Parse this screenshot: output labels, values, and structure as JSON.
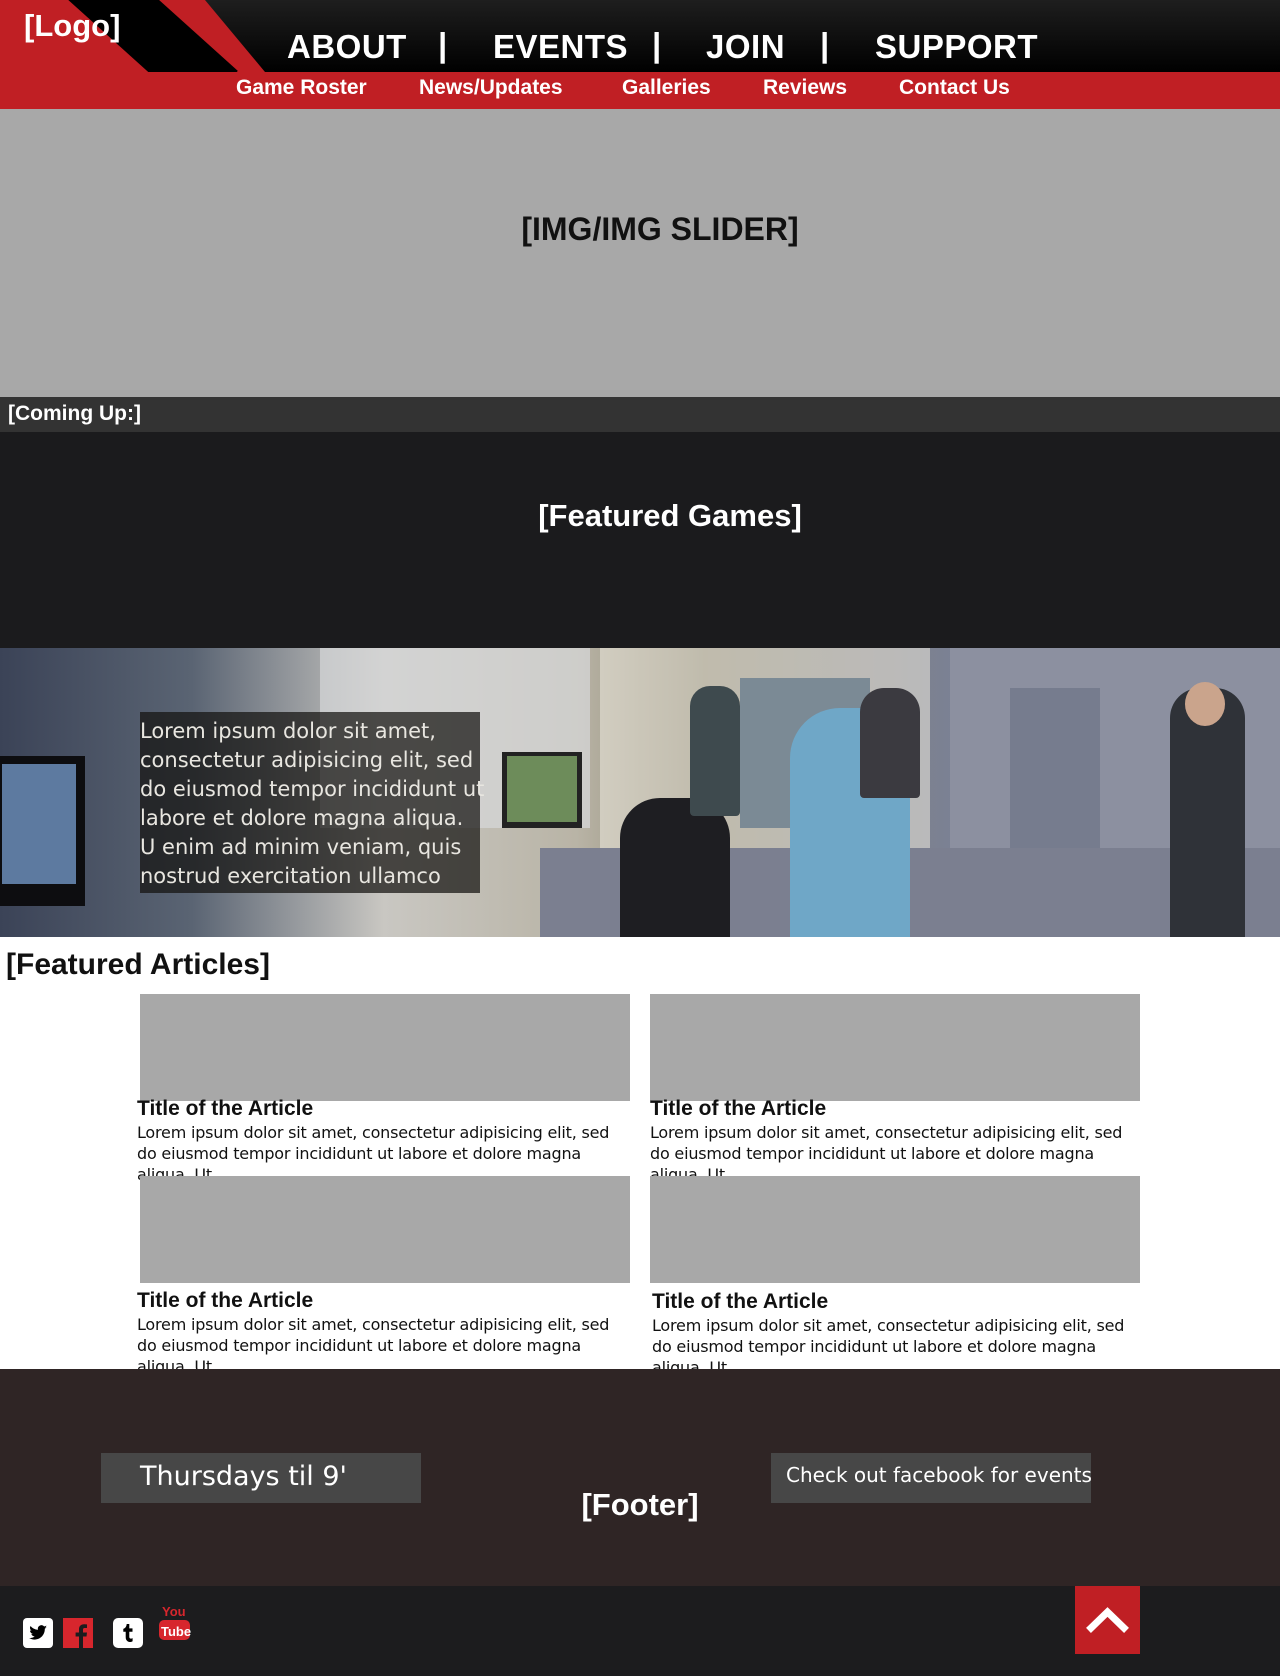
{
  "header": {
    "logo": "[Logo]",
    "main_nav": [
      "ABOUT",
      "EVENTS",
      "JOIN",
      "SUPPORT"
    ],
    "separator": "|",
    "sub_nav": [
      "Game Roster",
      "News/Updates",
      "Galleries",
      "Reviews",
      "Contact Us"
    ]
  },
  "slider": {
    "label": "[IMG/IMG SLIDER]"
  },
  "coming_up": {
    "label": "[Coming Up:]"
  },
  "featured_games": {
    "label": "[Featured Games]"
  },
  "photo_band": {
    "text": "Lorem ipsum dolor sit amet, consectetur adipisicing elit, sed do eiusmod tempor incididunt ut labore et dolore magna aliqua. U enim ad minim veniam, quis nostrud exercitation ullamco"
  },
  "featured_articles": {
    "heading": "[Featured Articles]",
    "items": [
      {
        "title": "Title of the Article",
        "body": "Lorem ipsum dolor sit amet, consectetur adipisicing elit, sed do eiusmod tempor incididunt ut labore et dolore magna aliqua. Ut"
      },
      {
        "title": "Title of the Article",
        "body": "Lorem ipsum dolor sit amet, consectetur adipisicing elit, sed do eiusmod tempor incididunt ut labore et dolore magna aliqua. Ut"
      },
      {
        "title": "Title of the Article",
        "body": "Lorem ipsum dolor sit amet, consectetur adipisicing elit, sed do eiusmod tempor incididunt ut labore et dolore magna aliqua. Ut"
      },
      {
        "title": "Title of the Article",
        "body": "Lorem ipsum dolor sit amet, consectetur adipisicing elit, sed do eiusmod tempor incididunt ut labore et dolore magna aliqua. Ut"
      }
    ]
  },
  "footer": {
    "hours": "Thursdays til 9'",
    "label": "[Footer]",
    "facebook_note": "Check out facebook for events"
  },
  "bottom_bar": {
    "social_icons": [
      "twitter-icon",
      "facebook-icon",
      "tumblr-icon",
      "youtube-icon"
    ],
    "youtube_text_top": "You",
    "youtube_text_bottom": "Tube"
  },
  "colors": {
    "accent": "#c01f24",
    "dark": "#1b1b1d",
    "footer": "#2f2525",
    "placeholder": "#a8a8a8"
  }
}
